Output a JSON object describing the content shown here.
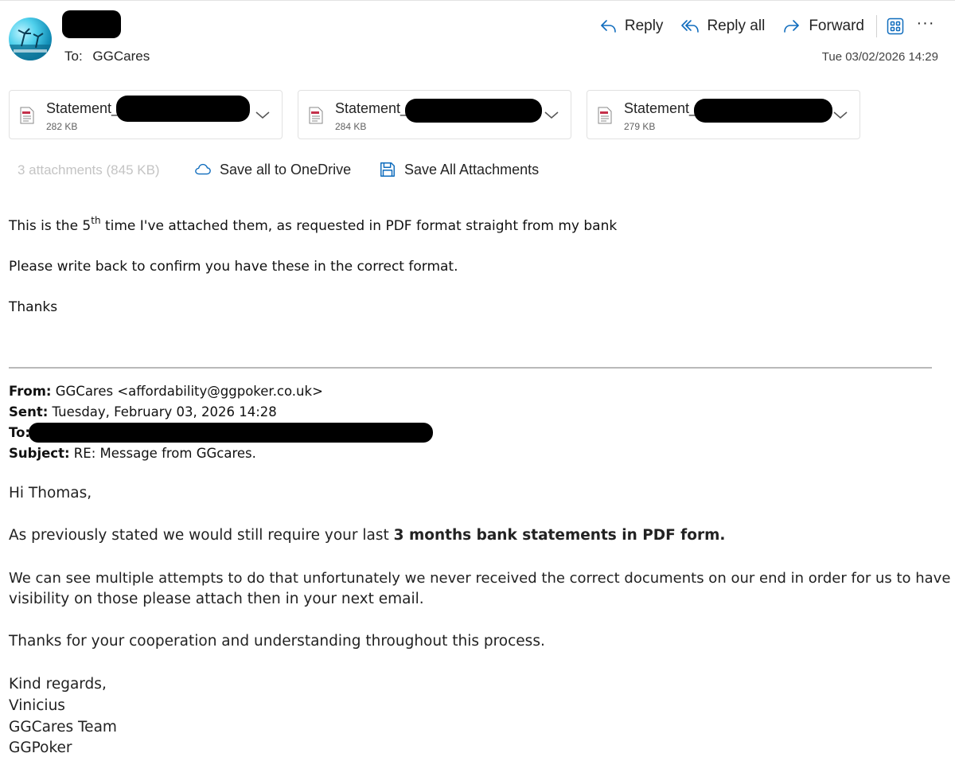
{
  "header": {
    "to_label": "To:",
    "to_value": "GGCares",
    "date": "Tue 03/02/2026 14:29",
    "reply": "Reply",
    "reply_all": "Reply all",
    "forward": "Forward"
  },
  "attachments": {
    "items": [
      {
        "name": "Statement_",
        "size": "282 KB"
      },
      {
        "name": "Statement_",
        "size": "284 KB"
      },
      {
        "name": "Statement_",
        "size": "279 KB"
      }
    ],
    "summary": "3 attachments (845 KB)",
    "save_onedrive": "Save all to OneDrive",
    "save_all": "Save All Attachments"
  },
  "message": {
    "line1_a": "This is the 5",
    "line1_sup": "th",
    "line1_b": " time I've attached them, as requested in PDF format straight from my bank",
    "line2": "Please write back to confirm you have these in the correct format.",
    "line3": "Thanks"
  },
  "quoted": {
    "from_label": "From:",
    "from_value": " GGCares <affordability@ggpoker.co.uk>",
    "sent_label": "Sent:",
    "sent_value": " Tuesday, February 03, 2026 14:28",
    "to_label": "To:",
    "subject_label": "Subject:",
    "subject_value": " RE: Message from GGcares.",
    "greeting": "Hi Thomas,",
    "p1_a": "As previously stated we would still require your last ",
    "p1_b": "3 months bank statements in PDF form.",
    "p2_l1": "We can see multiple attempts to do that unfortunately we never received the correct documents on our end in order for us to have",
    "p2_l2": "visibility on those please attach then in your next email.",
    "p3": "Thanks for your cooperation and understanding throughout this process.",
    "sig1": "Kind regards,",
    "sig2": "Vinicius",
    "sig3": "GGCares Team",
    "sig4": "GGPoker"
  },
  "colors": {
    "accent_icon": "#0f6cbd",
    "pdf_red": "#c4314b",
    "muted": "#c4c4c4"
  }
}
